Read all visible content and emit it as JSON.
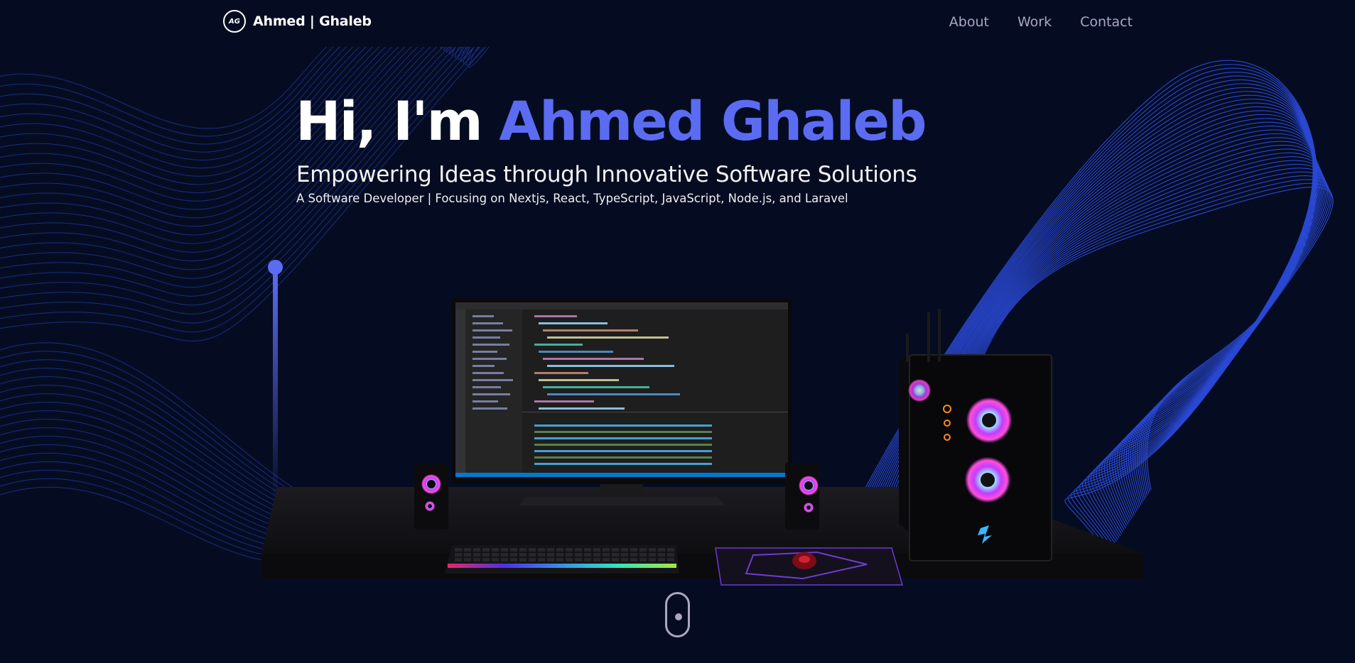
{
  "navbar": {
    "logo_text": "AG",
    "brand_name": "Ahmed | Ghaleb",
    "links": [
      "About",
      "Work",
      "Contact"
    ]
  },
  "hero": {
    "title_prefix": "Hi, I'm",
    "title_name": "Ahmed Ghaleb",
    "subtitle": "Empowering Ideas through Innovative Software Solutions",
    "description": "A Software Developer | Focusing on Nextjs, React, TypeScript, JavaScript, Node.js, and Laravel"
  },
  "colors": {
    "background": "#050c22",
    "accent": "#5b6cf2",
    "nav_text": "#aaa6c3"
  }
}
